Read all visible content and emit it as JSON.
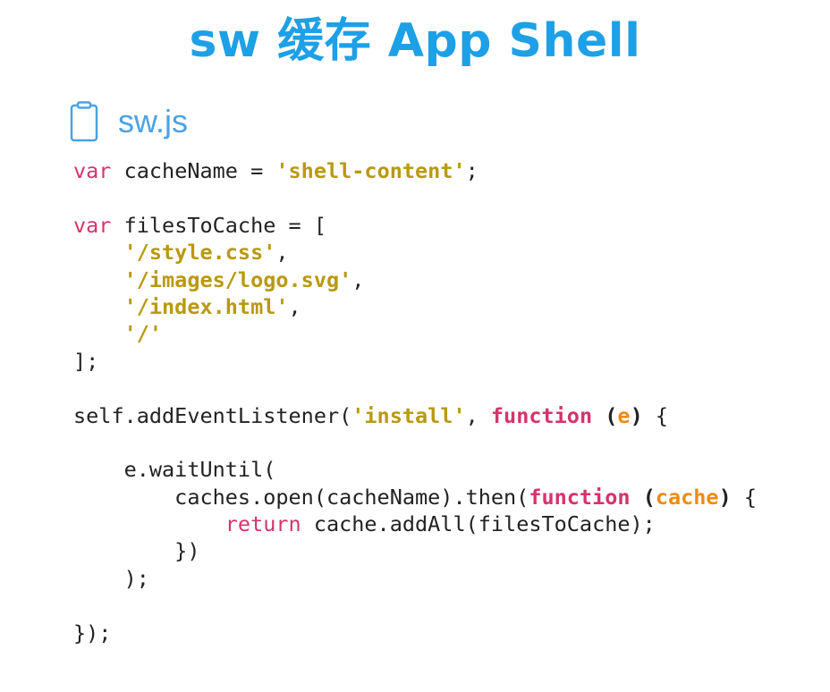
{
  "slide": {
    "title": "sw 缓存 App Shell",
    "file_name": "sw.js",
    "file_icon": "clipboard-icon",
    "colors": {
      "title": "#1ea0e6",
      "file_name": "#4ba3e3",
      "keyword": "#d6336c",
      "string": "#b89a10",
      "parameter": "#ef8b0f",
      "text": "#222222"
    }
  },
  "code": {
    "lines": [
      [
        {
          "t": "kw",
          "v": "var"
        },
        {
          "t": "plain",
          "v": " cacheName = "
        },
        {
          "t": "str",
          "v": "'shell-content'"
        },
        {
          "t": "plain",
          "v": ";"
        }
      ],
      [],
      [
        {
          "t": "kw",
          "v": "var"
        },
        {
          "t": "plain",
          "v": " filesToCache = ["
        }
      ],
      [
        {
          "t": "plain",
          "v": "    "
        },
        {
          "t": "str",
          "v": "'/style.css'"
        },
        {
          "t": "plain",
          "v": ","
        }
      ],
      [
        {
          "t": "plain",
          "v": "    "
        },
        {
          "t": "str",
          "v": "'/images/logo.svg'"
        },
        {
          "t": "plain",
          "v": ","
        }
      ],
      [
        {
          "t": "plain",
          "v": "    "
        },
        {
          "t": "str",
          "v": "'/index.html'"
        },
        {
          "t": "plain",
          "v": ","
        }
      ],
      [
        {
          "t": "plain",
          "v": "    "
        },
        {
          "t": "str",
          "v": "'/'"
        }
      ],
      [
        {
          "t": "plain",
          "v": "];"
        }
      ],
      [],
      [
        {
          "t": "plain",
          "v": "self.addEventListener("
        },
        {
          "t": "str",
          "v": "'install'"
        },
        {
          "t": "plain",
          "v": ", "
        },
        {
          "t": "fn",
          "v": "function"
        },
        {
          "t": "plain",
          "v": " "
        },
        {
          "t": "punctb",
          "v": "("
        },
        {
          "t": "param",
          "v": "e"
        },
        {
          "t": "punctb",
          "v": ")"
        },
        {
          "t": "plain",
          "v": " {"
        }
      ],
      [],
      [
        {
          "t": "plain",
          "v": "    e.waitUntil("
        }
      ],
      [
        {
          "t": "plain",
          "v": "        caches.open(cacheName).then("
        },
        {
          "t": "fn",
          "v": "function"
        },
        {
          "t": "plain",
          "v": " "
        },
        {
          "t": "punctb",
          "v": "("
        },
        {
          "t": "param",
          "v": "cache"
        },
        {
          "t": "punctb",
          "v": ")"
        },
        {
          "t": "plain",
          "v": " {"
        }
      ],
      [
        {
          "t": "plain",
          "v": "            "
        },
        {
          "t": "kw",
          "v": "return"
        },
        {
          "t": "plain",
          "v": " cache.addAll(filesToCache);"
        }
      ],
      [
        {
          "t": "plain",
          "v": "        })"
        }
      ],
      [
        {
          "t": "plain",
          "v": "    );"
        }
      ],
      [],
      [
        {
          "t": "plain",
          "v": "});"
        }
      ]
    ]
  }
}
